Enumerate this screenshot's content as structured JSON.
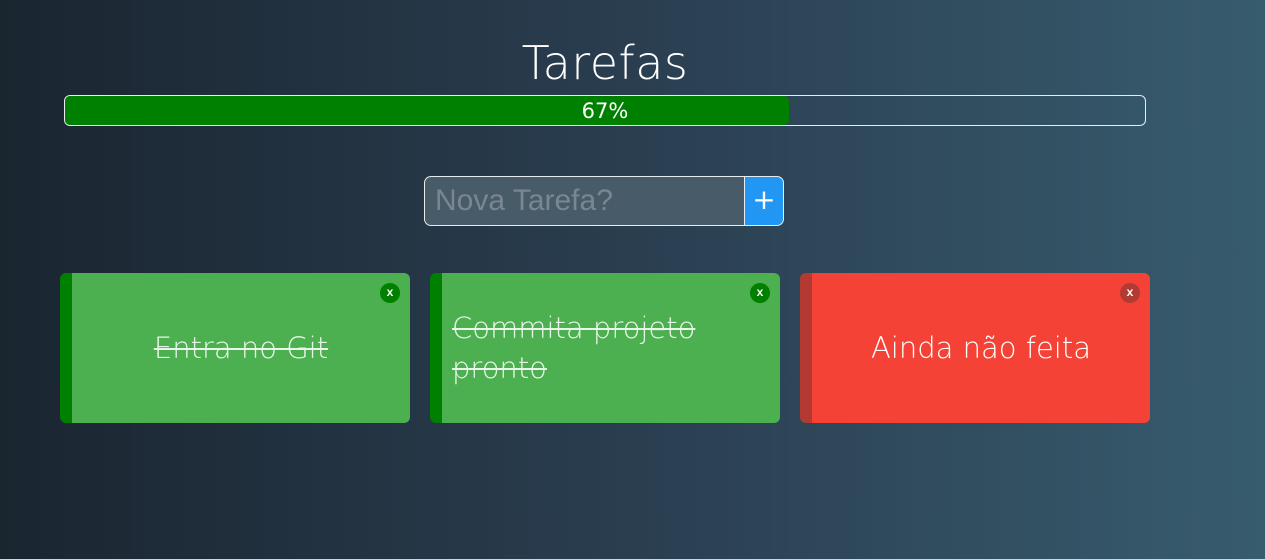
{
  "header": {
    "title": "Tarefas"
  },
  "progress": {
    "percent": 67,
    "label": "67%",
    "fill_color": "#008000"
  },
  "new_task": {
    "placeholder": "Nova Tarefa?",
    "value": "",
    "add_label": "+"
  },
  "tasks": [
    {
      "text": "Entra no Git",
      "done": true,
      "close_label": "x"
    },
    {
      "text": "Commita projeto pronto",
      "done": true,
      "close_label": "x"
    },
    {
      "text": "Ainda não feita",
      "done": false,
      "close_label": "x"
    }
  ],
  "colors": {
    "done_bg": "#4caf50",
    "done_accent": "#008000",
    "pending_bg": "#f44336",
    "pending_accent": "#b33a32",
    "add_button": "#2196f3"
  }
}
